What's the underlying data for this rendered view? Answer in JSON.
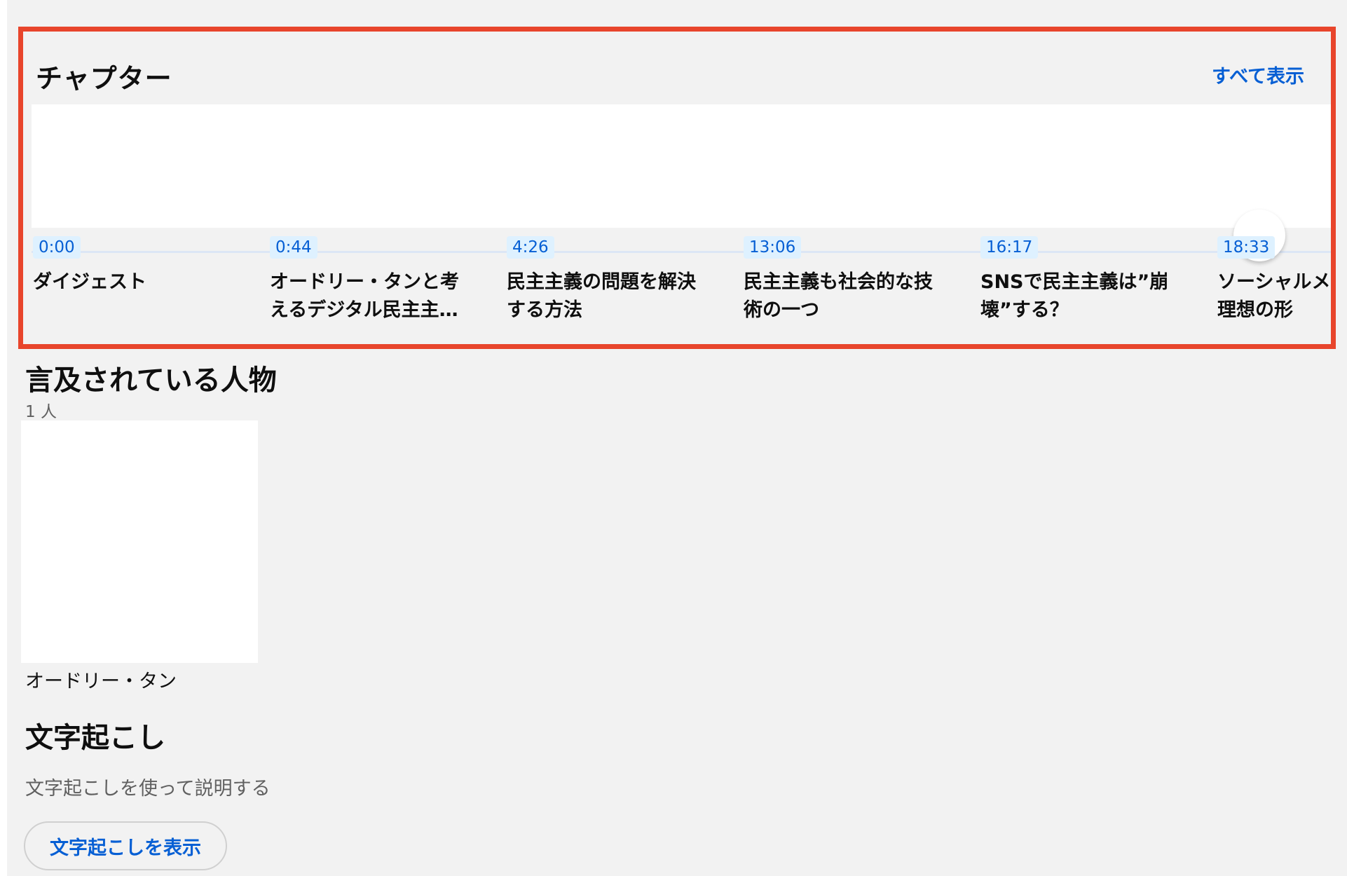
{
  "chapters": {
    "title": "チャプター",
    "show_all_label": "すべて表示",
    "items": [
      {
        "time": "0:00",
        "title": "ダイジェスト"
      },
      {
        "time": "0:44",
        "title": "オードリー・タンと考\nえるデジタル民主主…"
      },
      {
        "time": "4:26",
        "title": "民主主義の問題を解決\nする方法"
      },
      {
        "time": "13:06",
        "title": "民主主義も社会的な技\n術の一つ"
      },
      {
        "time": "16:17",
        "title": "SNSで民主主義は”崩\n壊”する？"
      },
      {
        "time": "18:33",
        "title": "ソーシャルメ\n理想の形"
      }
    ]
  },
  "people": {
    "title": "言及されている人物",
    "count": "1 人",
    "items": [
      {
        "name": "オードリー・タン"
      }
    ]
  },
  "transcript": {
    "title": "文字起こし",
    "description": "文字起こしを使って説明する",
    "button_label": "文字起こしを表示"
  },
  "colors": {
    "highlight_border": "#e8452c",
    "link_blue": "#065fd4",
    "background": "#f2f2f2"
  }
}
